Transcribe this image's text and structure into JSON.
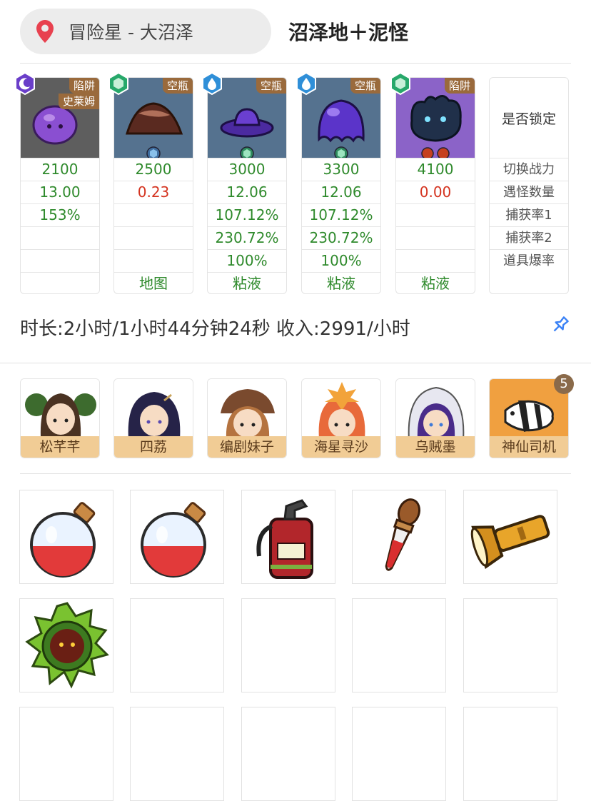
{
  "header": {
    "location": "冒险星 - 大沼泽",
    "title": "沼泽地＋泥怪"
  },
  "monsters": [
    {
      "tag": "陷阱",
      "tag2": "史莱姆",
      "element": "moon-icon",
      "power": "2100",
      "count": "13.00",
      "catch1": "153%",
      "catch2": "",
      "drop": "",
      "item": ""
    },
    {
      "tag": "空瓶",
      "tag2": "",
      "element": "leaf-icon",
      "power": "2500",
      "count": "0.23",
      "catch1": "",
      "catch2": "",
      "drop": "",
      "item": "地图"
    },
    {
      "tag": "空瓶",
      "tag2": "",
      "element": "water-icon",
      "power": "3000",
      "count": "12.06",
      "catch1": "107.12%",
      "catch2": "230.72%",
      "drop": "100%",
      "item": "粘液"
    },
    {
      "tag": "空瓶",
      "tag2": "",
      "element": "water-icon",
      "power": "3300",
      "count": "12.06",
      "catch1": "107.12%",
      "catch2": "230.72%",
      "drop": "100%",
      "item": "粘液"
    },
    {
      "tag": "陷阱",
      "tag2": "",
      "element": "leaf-icon",
      "power": "4100",
      "count": "0.00",
      "catch1": "",
      "catch2": "",
      "drop": "",
      "item": "粘液"
    }
  ],
  "lock_column": {
    "title": "是否锁定",
    "rows": [
      "切换战力",
      "遇怪数量",
      "捕获率1",
      "捕获率2",
      "道具爆率"
    ]
  },
  "summary": "时长:2小时/1小时44分钟24秒 收入:2991/小时",
  "characters": [
    {
      "name": "松芊芊"
    },
    {
      "name": "四荔"
    },
    {
      "name": "编剧妹子"
    },
    {
      "name": "海星寻沙"
    },
    {
      "name": "乌贼墨"
    },
    {
      "name": "神仙司机",
      "badge": "5"
    }
  ],
  "items": [
    {
      "icon": "red-potion-icon"
    },
    {
      "icon": "red-potion-icon"
    },
    {
      "icon": "fire-extinguisher-icon"
    },
    {
      "icon": "dropper-icon"
    },
    {
      "icon": "flashlight-icon"
    },
    {
      "icon": "mud-monster-medal-icon"
    },
    {
      "icon": ""
    },
    {
      "icon": ""
    },
    {
      "icon": ""
    },
    {
      "icon": ""
    },
    {
      "icon": ""
    },
    {
      "icon": ""
    },
    {
      "icon": ""
    },
    {
      "icon": ""
    },
    {
      "icon": ""
    }
  ],
  "colors": {
    "green_value": "#2f8a2c",
    "red_value": "#d4331f",
    "tag_brown": "#9a6a3c",
    "name_bar": "#f1cc95",
    "pin_red": "#e8414f",
    "pin_blue": "#3b82f6"
  }
}
